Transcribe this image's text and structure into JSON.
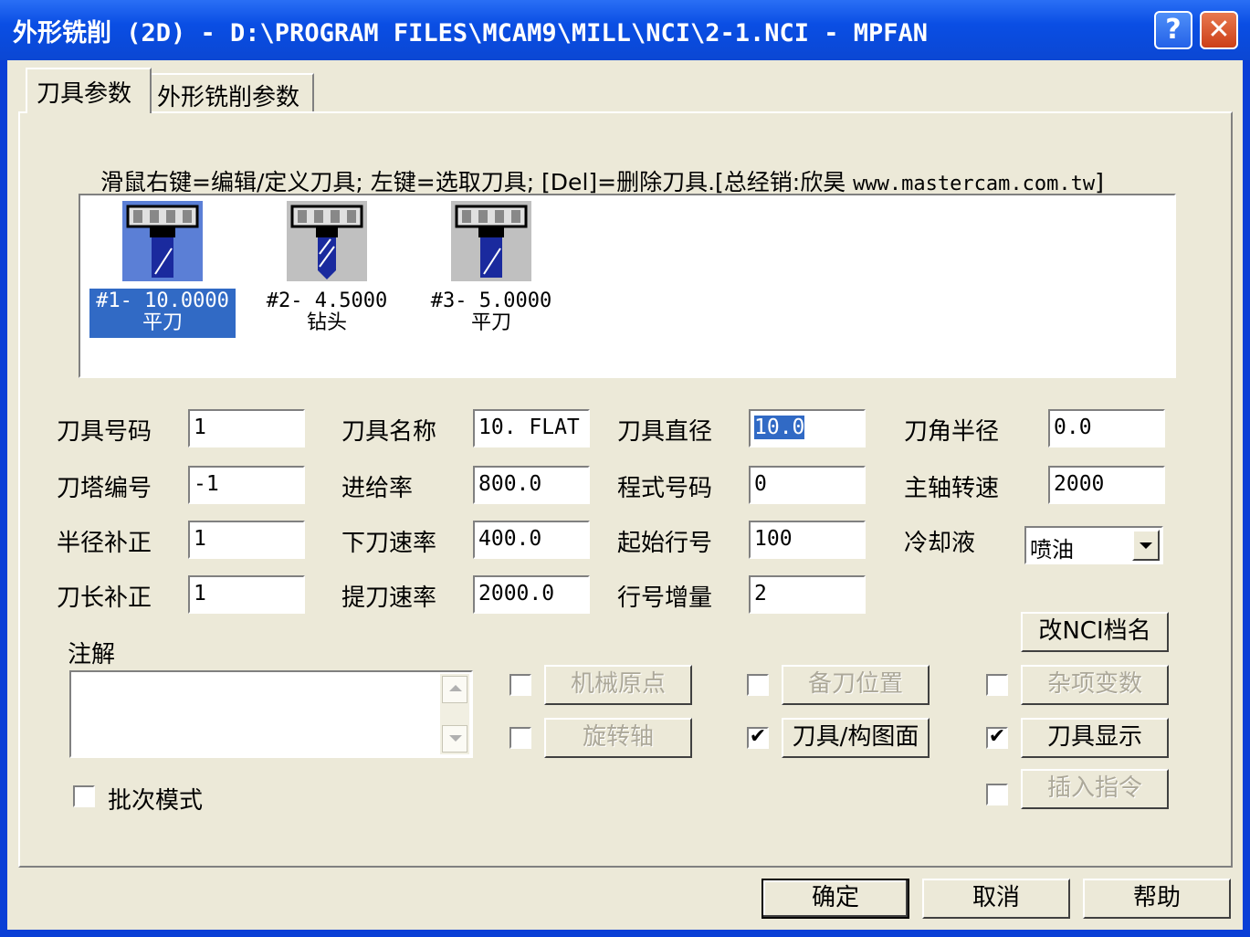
{
  "window": {
    "title": "外形铣削 (2D) - D:\\PROGRAM FILES\\MCAM9\\MILL\\NCI\\2-1.NCI - MPFAN",
    "help_glyph": "?",
    "close_glyph": "✕"
  },
  "tabs": [
    {
      "label": "刀具参数"
    },
    {
      "label": "外形铣削参数"
    }
  ],
  "hint": {
    "prefix": "滑鼠右键=编辑/定义刀具; 左键=选取刀具; [Del]=删除刀具.[总经销:欣昊 ",
    "url": "www.mastercam.com.tw",
    "suffix": "]"
  },
  "tools": [
    {
      "number": "#1- 10.0000",
      "type": "平刀"
    },
    {
      "number": "#2- 4.5000",
      "type": "钻头"
    },
    {
      "number": "#3- 5.0000",
      "type": "平刀"
    }
  ],
  "params": {
    "tool_number": {
      "label": "刀具号码",
      "value": "1"
    },
    "tool_name": {
      "label": "刀具名称",
      "value": " 10. FLAT"
    },
    "tool_diameter": {
      "label": "刀具直径",
      "value": "10.0"
    },
    "corner_radius": {
      "label": "刀角半径",
      "value": "0.0"
    },
    "turret_number": {
      "label": "刀塔编号",
      "value": "-1"
    },
    "feed_rate": {
      "label": "进给率",
      "value": "800.0"
    },
    "program_number": {
      "label": "程式号码",
      "value": "0"
    },
    "spindle_speed": {
      "label": "主轴转速",
      "value": "2000"
    },
    "radius_comp": {
      "label": "半径补正",
      "value": "1"
    },
    "plunge_rate": {
      "label": "下刀速率",
      "value": "400.0"
    },
    "start_line": {
      "label": "起始行号",
      "value": "100"
    },
    "coolant": {
      "label": "冷却液",
      "value": "喷油"
    },
    "length_comp": {
      "label": "刀长补正",
      "value": "1"
    },
    "retract_rate": {
      "label": "提刀速率",
      "value": "2000.0"
    },
    "line_increment": {
      "label": "行号增量",
      "value": "2"
    }
  },
  "comment": {
    "label": "注解",
    "value": ""
  },
  "batch": {
    "label": "批次模式",
    "checked": false
  },
  "buttons": {
    "rename_nci": "改NCI档名",
    "home_position": {
      "label": "机械原点",
      "checked": false
    },
    "tool_change_pos": {
      "label": "备刀位置",
      "checked": false
    },
    "misc_values": {
      "label": "杂项变数",
      "checked": false
    },
    "rotary_axis": {
      "label": "旋转轴",
      "checked": false
    },
    "tool_plane": {
      "label": "刀具/构图面",
      "checked": true
    },
    "tool_display": {
      "label": "刀具显示",
      "checked": true
    },
    "insert_command": {
      "label": "插入指令",
      "checked": false
    },
    "ok": "确定",
    "cancel": "取消",
    "help": "帮助"
  },
  "check_glyph": "✔"
}
